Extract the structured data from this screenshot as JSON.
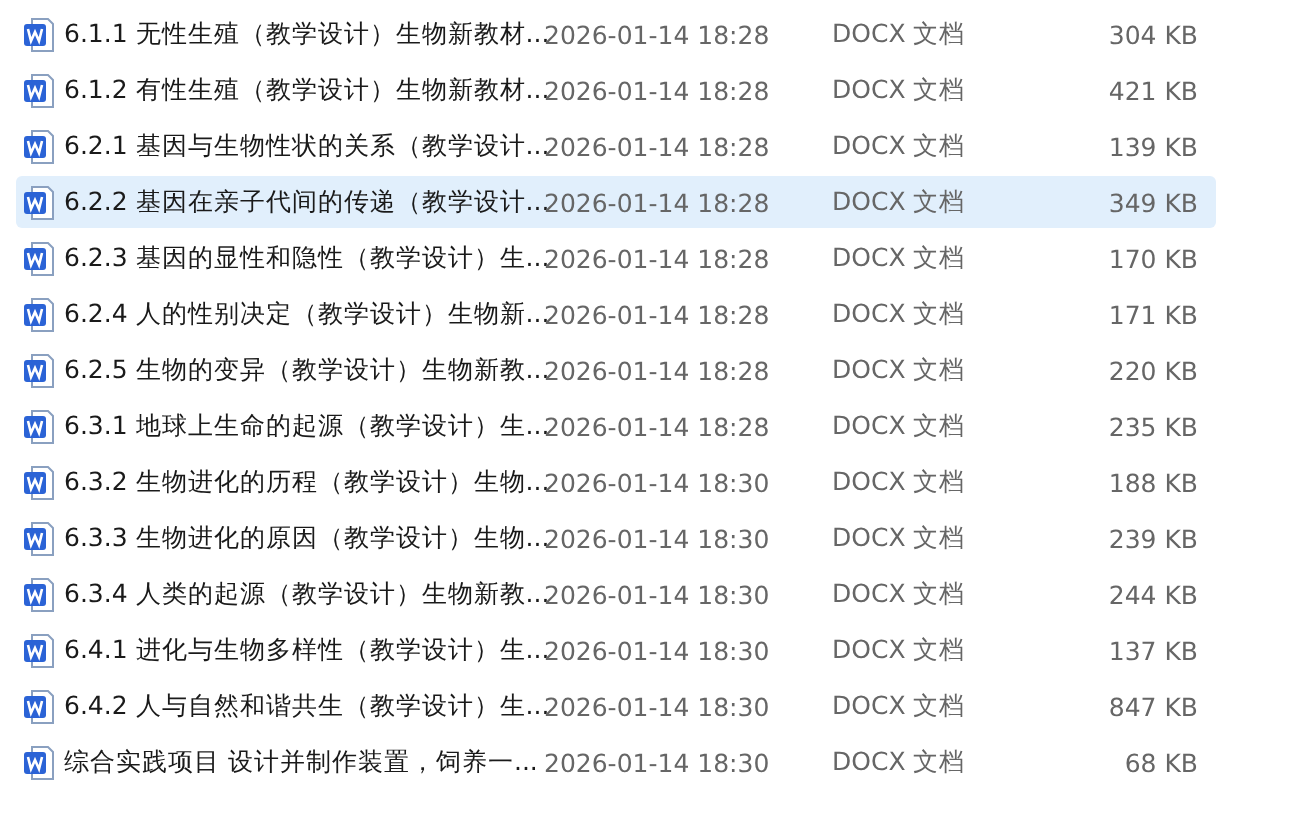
{
  "files": [
    {
      "name": "6.1.1 无性生殖（教学设计）生物新教材...",
      "modified": "2026-01-14 18:28",
      "type": "DOCX 文档",
      "size": "304 KB",
      "selected": false
    },
    {
      "name": "6.1.2 有性生殖（教学设计）生物新教材...",
      "modified": "2026-01-14 18:28",
      "type": "DOCX 文档",
      "size": "421 KB",
      "selected": false
    },
    {
      "name": "6.2.1 基因与生物性状的关系（教学设计...",
      "modified": "2026-01-14 18:28",
      "type": "DOCX 文档",
      "size": "139 KB",
      "selected": false
    },
    {
      "name": "6.2.2 基因在亲子代间的传递（教学设计...",
      "modified": "2026-01-14 18:28",
      "type": "DOCX 文档",
      "size": "349 KB",
      "selected": true
    },
    {
      "name": "6.2.3 基因的显性和隐性（教学设计）生...",
      "modified": "2026-01-14 18:28",
      "type": "DOCX 文档",
      "size": "170 KB",
      "selected": false
    },
    {
      "name": "6.2.4 人的性别决定（教学设计）生物新...",
      "modified": "2026-01-14 18:28",
      "type": "DOCX 文档",
      "size": "171 KB",
      "selected": false
    },
    {
      "name": "6.2.5 生物的变异（教学设计）生物新教...",
      "modified": "2026-01-14 18:28",
      "type": "DOCX 文档",
      "size": "220 KB",
      "selected": false
    },
    {
      "name": "6.3.1 地球上生命的起源（教学设计）生...",
      "modified": "2026-01-14 18:28",
      "type": "DOCX 文档",
      "size": "235 KB",
      "selected": false
    },
    {
      "name": "6.3.2 生物进化的历程（教学设计）生物...",
      "modified": "2026-01-14 18:30",
      "type": "DOCX 文档",
      "size": "188 KB",
      "selected": false
    },
    {
      "name": "6.3.3 生物进化的原因（教学设计）生物...",
      "modified": "2026-01-14 18:30",
      "type": "DOCX 文档",
      "size": "239 KB",
      "selected": false
    },
    {
      "name": "6.3.4 人类的起源（教学设计）生物新教...",
      "modified": "2026-01-14 18:30",
      "type": "DOCX 文档",
      "size": "244 KB",
      "selected": false
    },
    {
      "name": "6.4.1 进化与生物多样性（教学设计）生...",
      "modified": "2026-01-14 18:30",
      "type": "DOCX 文档",
      "size": "137 KB",
      "selected": false
    },
    {
      "name": "6.4.2 人与自然和谐共生（教学设计）生...",
      "modified": "2026-01-14 18:30",
      "type": "DOCX 文档",
      "size": "847 KB",
      "selected": false
    },
    {
      "name": "综合实践项目 设计并制作装置，饲养一...",
      "modified": "2026-01-14 18:30",
      "type": "DOCX 文档",
      "size": "68 KB",
      "selected": false
    }
  ]
}
